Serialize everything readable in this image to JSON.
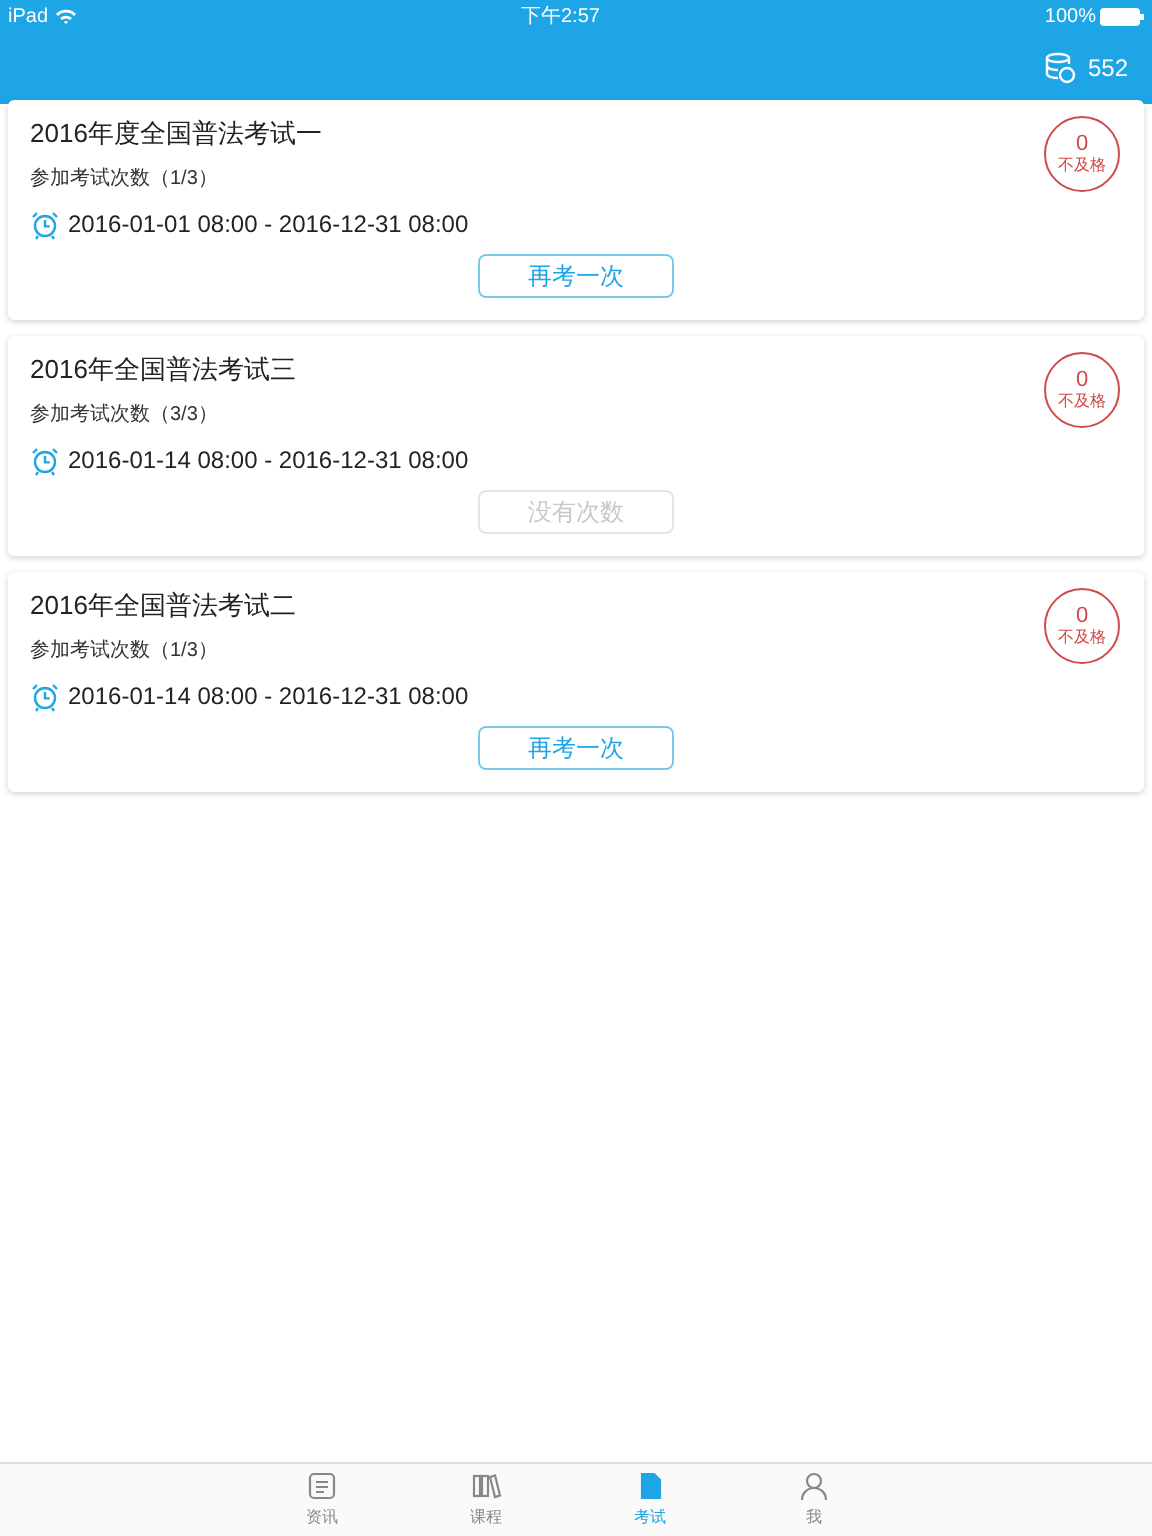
{
  "status_bar": {
    "device": "iPad",
    "time": "下午2:57",
    "battery": "100%"
  },
  "nav_bar": {
    "coins": "552"
  },
  "exams": [
    {
      "title": "2016年度全国普法考试一",
      "attempts": "参加考试次数（1/3）",
      "period": "2016-01-01 08:00 - 2016-12-31 08:00",
      "score": "0",
      "result": "不及格",
      "button": "再考一次",
      "disabled": false
    },
    {
      "title": "2016年全国普法考试三",
      "attempts": "参加考试次数（3/3）",
      "period": "2016-01-14 08:00 - 2016-12-31 08:00",
      "score": "0",
      "result": "不及格",
      "button": "没有次数",
      "disabled": true
    },
    {
      "title": "2016年全国普法考试二",
      "attempts": "参加考试次数（1/3）",
      "period": "2016-01-14 08:00 - 2016-12-31 08:00",
      "score": "0",
      "result": "不及格",
      "button": "再考一次",
      "disabled": false
    }
  ],
  "tabs": [
    {
      "label": "资讯",
      "selected": false
    },
    {
      "label": "课程",
      "selected": false
    },
    {
      "label": "考试",
      "selected": true
    },
    {
      "label": "我",
      "selected": false
    }
  ]
}
